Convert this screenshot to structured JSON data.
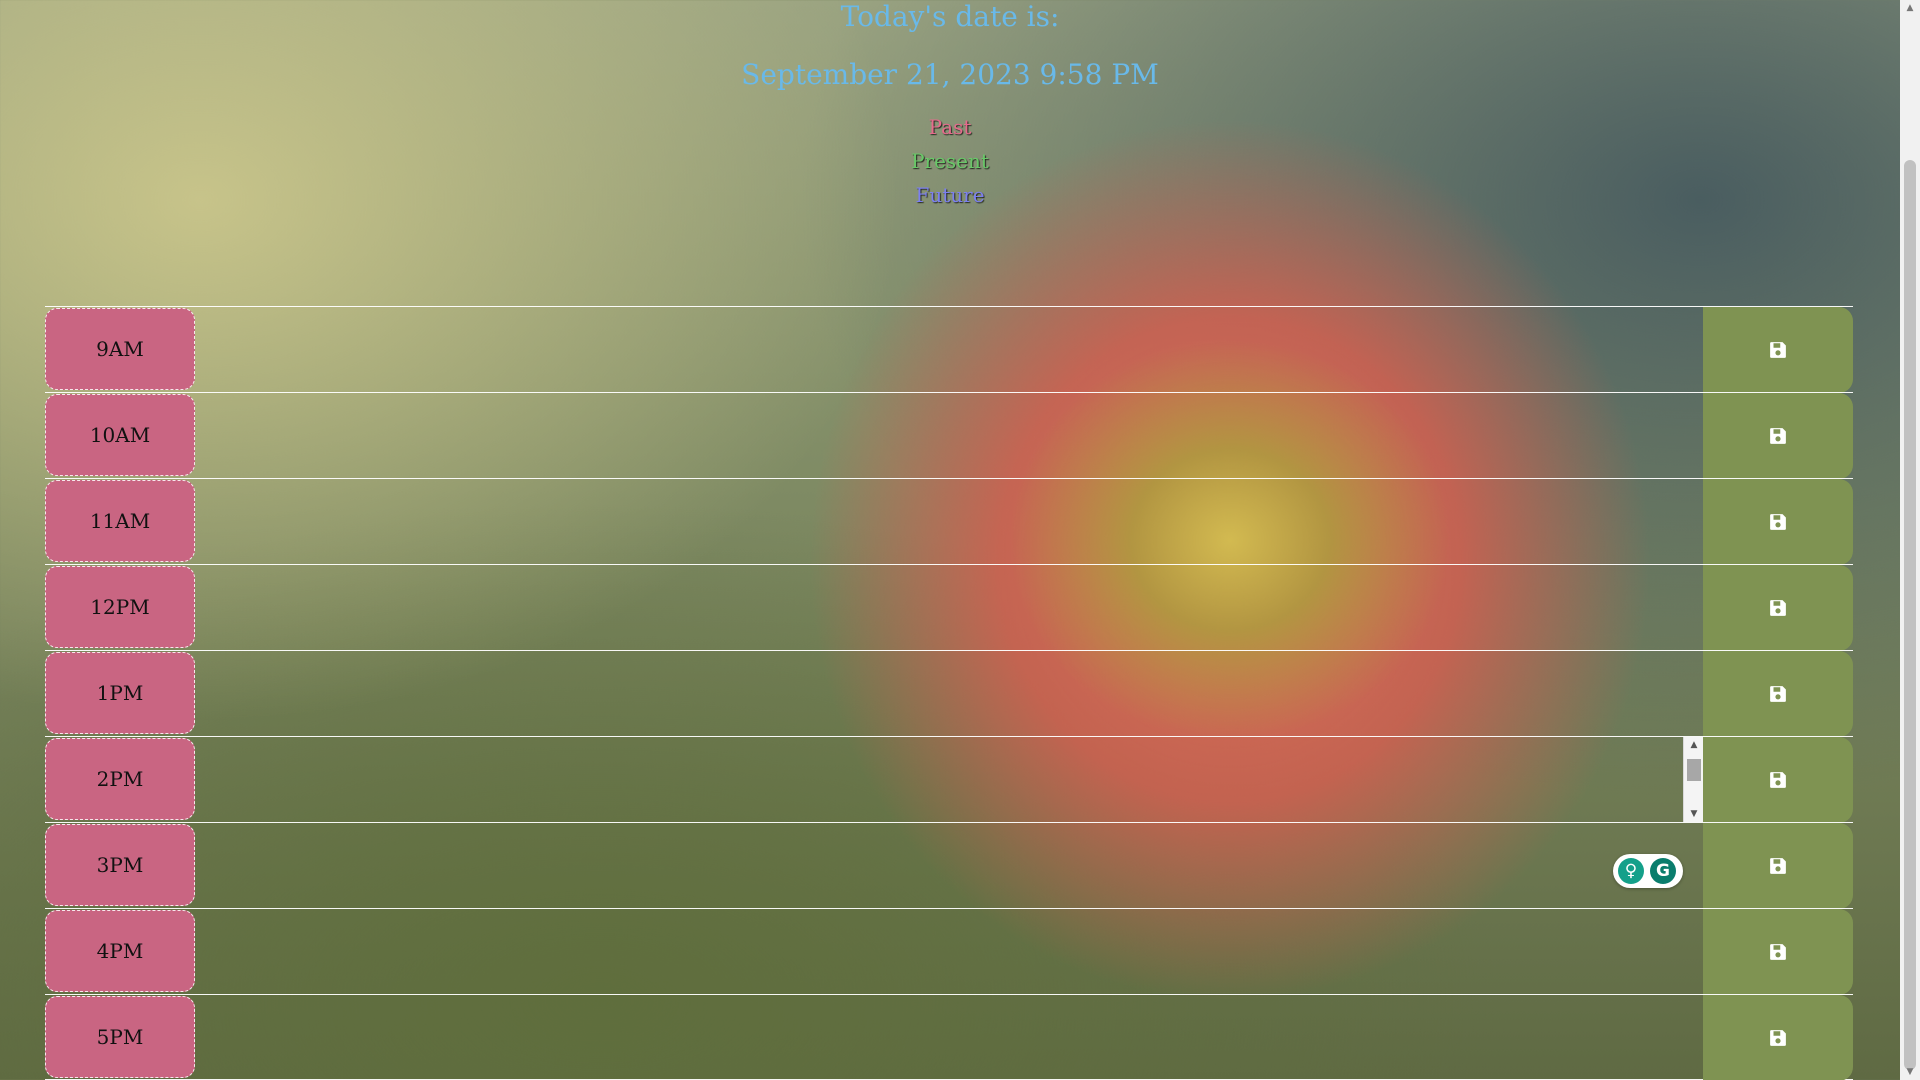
{
  "header": {
    "date_label": "Today's date is:",
    "date_value": "September 21, 2023 9:58 PM"
  },
  "legend": {
    "past": "Past",
    "present": "Present",
    "future": "Future"
  },
  "scheduler": {
    "hours": [
      "9AM",
      "10AM",
      "11AM",
      "12PM",
      "1PM",
      "2PM",
      "3PM",
      "4PM",
      "5PM"
    ],
    "descriptions": [
      "",
      "",
      "",
      "",
      "",
      "",
      "",
      "",
      ""
    ]
  },
  "icons": {
    "save": "floppy-disk-icon",
    "grammarly": "grammarly-icon"
  },
  "grammarly": {
    "g1": "♀",
    "g2": "G"
  },
  "scrollbar": {
    "up": "▲",
    "down": "▼"
  },
  "colors": {
    "accent_text": "#69b9e9",
    "past": "#e56b8c",
    "present": "#69c768",
    "future": "#7c80ef",
    "hour_block": "#c96582",
    "save_block": "#7f9352"
  }
}
